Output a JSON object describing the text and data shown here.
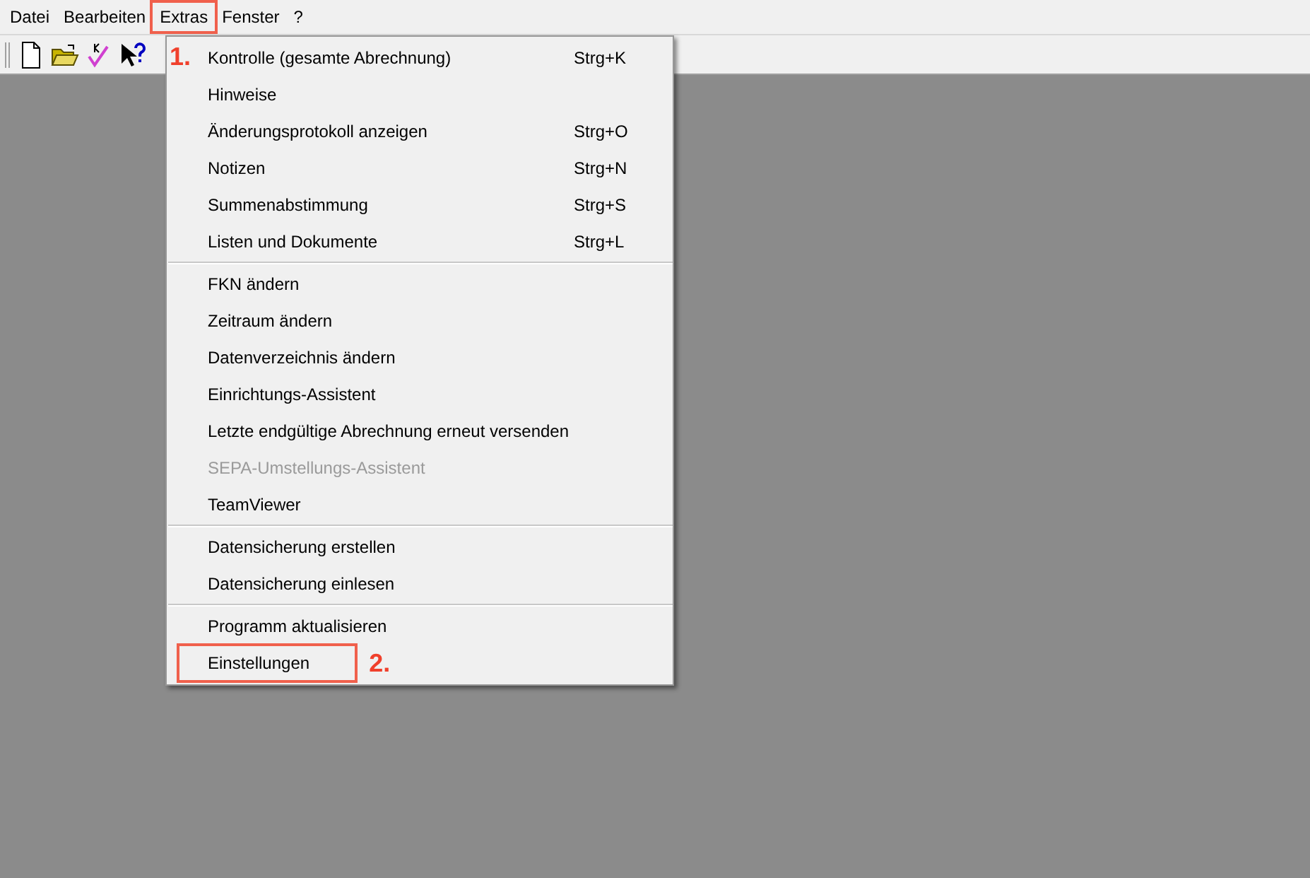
{
  "menu_bar": [
    {
      "label": "Datei",
      "highlighted": false
    },
    {
      "label": "Bearbeiten",
      "highlighted": false
    },
    {
      "label": "Extras",
      "highlighted": true
    },
    {
      "label": "Fenster",
      "highlighted": false
    },
    {
      "label": "?",
      "highlighted": false
    }
  ],
  "menu": [
    {
      "kind": "item",
      "label": "Kontrolle (gesamte Abrechnung)",
      "shortcut": "Strg+K",
      "disabled": false,
      "highlighted": false,
      "step": "1."
    },
    {
      "kind": "item",
      "label": "Hinweise",
      "disabled": false,
      "highlighted": false
    },
    {
      "kind": "item",
      "label": "Änderungsprotokoll anzeigen",
      "shortcut": "Strg+O",
      "disabled": false,
      "highlighted": false
    },
    {
      "kind": "item",
      "label": "Notizen",
      "shortcut": "Strg+N",
      "disabled": false,
      "highlighted": false
    },
    {
      "kind": "item",
      "label": "Summenabstimmung",
      "shortcut": "Strg+S",
      "disabled": false,
      "highlighted": false
    },
    {
      "kind": "item",
      "label": "Listen und Dokumente",
      "shortcut": "Strg+L",
      "disabled": false,
      "highlighted": false
    },
    {
      "kind": "separator"
    },
    {
      "kind": "item",
      "label": "FKN ändern",
      "disabled": false,
      "highlighted": false
    },
    {
      "kind": "item",
      "label": "Zeitraum ändern",
      "disabled": false,
      "highlighted": false
    },
    {
      "kind": "item",
      "label": "Datenverzeichnis ändern",
      "disabled": false,
      "highlighted": false
    },
    {
      "kind": "item",
      "label": "Einrichtungs-Assistent",
      "disabled": false,
      "highlighted": false
    },
    {
      "kind": "item",
      "label": "Letzte endgültige Abrechnung erneut versenden",
      "disabled": false,
      "highlighted": false
    },
    {
      "kind": "item",
      "label": "SEPA-Umstellungs-Assistent",
      "disabled": true,
      "highlighted": false
    },
    {
      "kind": "item",
      "label": "TeamViewer",
      "disabled": false,
      "highlighted": false
    },
    {
      "kind": "separator"
    },
    {
      "kind": "item",
      "label": "Datensicherung erstellen",
      "disabled": false,
      "highlighted": false
    },
    {
      "kind": "item",
      "label": "Datensicherung einlesen",
      "disabled": false,
      "highlighted": false
    },
    {
      "kind": "separator"
    },
    {
      "kind": "item",
      "label": "Programm aktualisieren",
      "disabled": false,
      "highlighted": false
    },
    {
      "kind": "item",
      "label": "Einstellungen",
      "disabled": false,
      "highlighted": true,
      "step": "2."
    }
  ]
}
